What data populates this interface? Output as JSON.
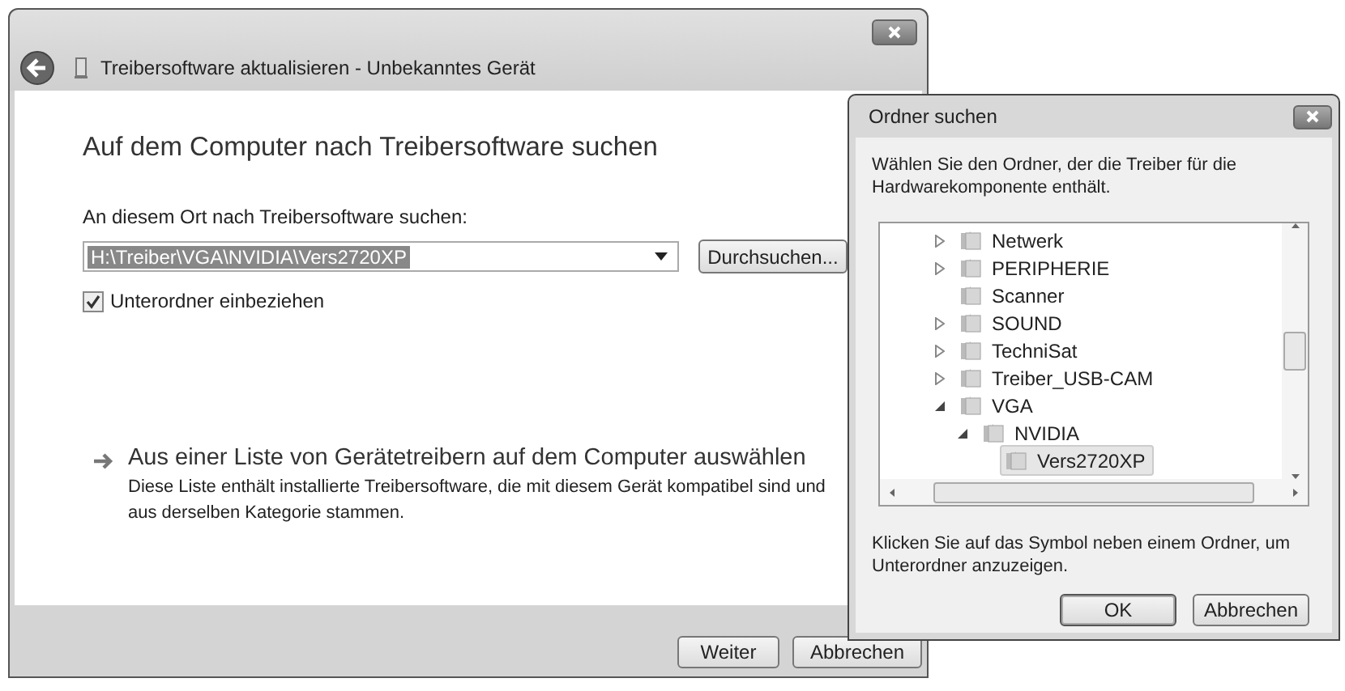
{
  "main_window": {
    "title": "Treibersoftware aktualisieren - Unbekanntes Gerät",
    "heading": "Auf dem Computer nach Treibersoftware suchen",
    "location_label": "An diesem Ort nach Treibersoftware suchen:",
    "location_value": "H:\\Treiber\\VGA\\NVIDIA\\Vers2720XP",
    "browse_button": "Durchsuchen...",
    "include_subfolders": {
      "label": "Unterordner einbeziehen",
      "checked": true
    },
    "list_option": {
      "title": "Aus einer Liste von Gerätetreibern auf dem Computer auswählen",
      "description": "Diese Liste enthält installierte Treibersoftware, die mit diesem Gerät kompatibel sind und aus derselben Kategorie stammen."
    },
    "buttons": [
      "Weiter",
      "Abbrechen"
    ]
  },
  "folder_dialog": {
    "title": "Ordner suchen",
    "description": "Wählen Sie den Ordner, der die Treiber für die Hardwarekomponente enthält.",
    "tree": [
      {
        "label": "Netwerk",
        "expanded": false,
        "selected": false
      },
      {
        "label": "PERIPHERIE",
        "expanded": false,
        "selected": false
      },
      {
        "label": "Scanner",
        "selected": false
      },
      {
        "label": "SOUND",
        "expanded": false,
        "selected": false
      },
      {
        "label": "TechniSat",
        "expanded": false,
        "selected": false
      },
      {
        "label": "Treiber_USB-CAM",
        "expanded": false,
        "selected": false
      },
      {
        "label": "VGA",
        "expanded": true,
        "selected": false,
        "children": [
          {
            "label": "NVIDIA",
            "expanded": true,
            "selected": false,
            "children": [
              {
                "label": "Vers2720XP",
                "selected": true
              }
            ]
          }
        ]
      }
    ],
    "hint": "Klicken Sie auf das Symbol neben einem Ordner, um Unterordner anzuzeigen.",
    "buttons": [
      "OK",
      "Abbrechen"
    ]
  }
}
